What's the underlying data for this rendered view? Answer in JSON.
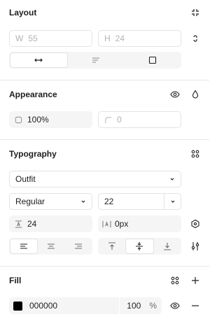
{
  "layout": {
    "title": "Layout",
    "width_prefix": "W",
    "width_value": "55",
    "height_prefix": "H",
    "height_value": "24"
  },
  "appearance": {
    "title": "Appearance",
    "opacity_value": "100%",
    "radius_value": "0"
  },
  "typography": {
    "title": "Typography",
    "font_family": "Outfit",
    "font_weight": "Regular",
    "font_size": "22",
    "line_height": "24",
    "letter_spacing": "0px"
  },
  "fill": {
    "title": "Fill",
    "color_swatch": "#000000",
    "hex_value": "000000",
    "opacity_value": "100",
    "percent_sign": "%"
  }
}
